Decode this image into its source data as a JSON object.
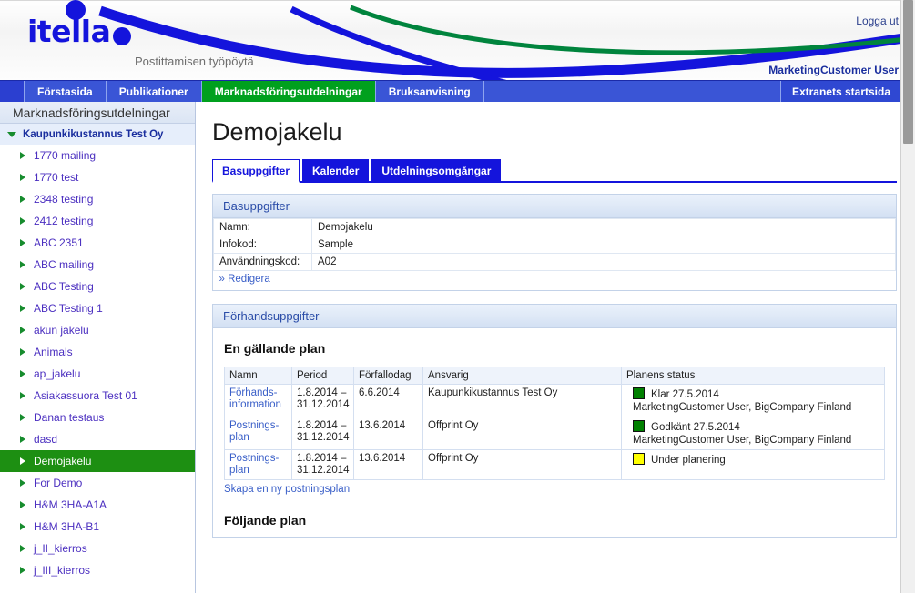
{
  "banner": {
    "logo_text": "itella",
    "tagline": "Postittamisen työpöytä",
    "logout_label": "Logga ut",
    "user_name": "MarketingCustomer User",
    "brand_blue": "#1414dc",
    "brand_green": "#00a01e"
  },
  "nav": {
    "items": [
      {
        "label": "Förstasida",
        "active": false
      },
      {
        "label": "Publikationer",
        "active": false
      },
      {
        "label": "Marknadsföringsutdelningar",
        "active": true
      },
      {
        "label": "Bruksanvisning",
        "active": false
      }
    ],
    "right_button": "Extranets startsida"
  },
  "sidebar": {
    "header": "Marknadsföringsutdelningar",
    "root": "Kaupunkikustannus Test Oy",
    "items": [
      {
        "label": "1770 mailing",
        "selected": false
      },
      {
        "label": "1770 test",
        "selected": false
      },
      {
        "label": "2348 testing",
        "selected": false
      },
      {
        "label": "2412 testing",
        "selected": false
      },
      {
        "label": "ABC 2351",
        "selected": false
      },
      {
        "label": "ABC mailing",
        "selected": false
      },
      {
        "label": "ABC Testing",
        "selected": false
      },
      {
        "label": "ABC Testing 1",
        "selected": false
      },
      {
        "label": "akun jakelu",
        "selected": false
      },
      {
        "label": "Animals",
        "selected": false
      },
      {
        "label": "ap_jakelu",
        "selected": false
      },
      {
        "label": "Asiakassuora Test 01",
        "selected": false
      },
      {
        "label": "Danan testaus",
        "selected": false
      },
      {
        "label": "dasd",
        "selected": false
      },
      {
        "label": "Demojakelu",
        "selected": true
      },
      {
        "label": "For Demo",
        "selected": false
      },
      {
        "label": "H&M 3HA-A1A",
        "selected": false
      },
      {
        "label": "H&M 3HA-B1",
        "selected": false
      },
      {
        "label": "j_II_kierros",
        "selected": false
      },
      {
        "label": "j_III_kierros",
        "selected": false
      }
    ]
  },
  "main": {
    "page_title": "Demojakelu",
    "tabs": [
      {
        "label": "Basuppgifter",
        "active": true
      },
      {
        "label": "Kalender",
        "active": false
      },
      {
        "label": "Utdelningsomgångar",
        "active": false
      }
    ],
    "basic_panel": {
      "header": "Basuppgifter",
      "rows": [
        {
          "label": "Namn:",
          "value": "Demojakelu"
        },
        {
          "label": "Infokod:",
          "value": "Sample"
        },
        {
          "label": "Användningskod:",
          "value": "A02"
        }
      ],
      "edit_link": "» Redigera"
    },
    "preview_panel": {
      "header": "Förhandsuppgifter",
      "current_plan_heading": "En gällande plan",
      "table": {
        "columns": [
          "Namn",
          "Period",
          "Förfallodag",
          "Ansvarig",
          "Planens status"
        ],
        "rows": [
          {
            "namn": "Förhands-information",
            "period": "1.8.2014 – 31.12.2014",
            "forfallodag": "6.6.2014",
            "ansvarig": "Kaupunkikustannus Test Oy",
            "status_color": "#008000",
            "status_text": "Klar 27.5.2014",
            "status_detail": "MarketingCustomer User, BigCompany Finland"
          },
          {
            "namn": "Postnings-plan",
            "period": "1.8.2014 – 31.12.2014",
            "forfallodag": "13.6.2014",
            "ansvarig": "Offprint Oy",
            "status_color": "#008000",
            "status_text": "Godkänt 27.5.2014",
            "status_detail": "MarketingCustomer User, BigCompany Finland"
          },
          {
            "namn": "Postnings-plan",
            "period": "1.8.2014 – 31.12.2014",
            "forfallodag": "13.6.2014",
            "ansvarig": "Offprint Oy",
            "status_color": "#ffff00",
            "status_text": "Under planering",
            "status_detail": ""
          }
        ]
      },
      "create_link": "Skapa en ny postningsplan",
      "next_plan_heading": "Följande plan"
    }
  }
}
